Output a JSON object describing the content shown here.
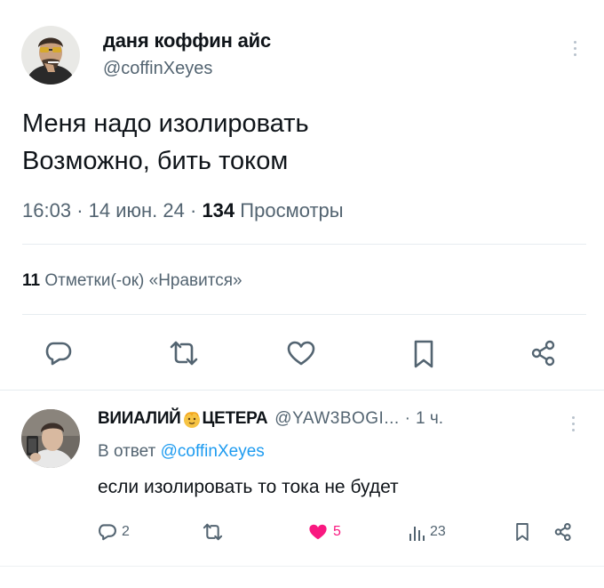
{
  "tweet": {
    "author_name": "даня коффин айс",
    "author_handle": "@coffinXeyes",
    "text_line1": "Меня надо изолировать",
    "text_line2": "Возможно, бить током",
    "time": "16:03",
    "sep1": "·",
    "date": "14 июн. 24",
    "sep2": "·",
    "views_count": "134",
    "views_label": "Просмотры",
    "likes_count": "11",
    "likes_label": "Отметки(-ок) «Нравится»"
  },
  "reply": {
    "author_name_part1": "ВИИАЛИЙ",
    "author_name_part2": "ЦЕТЕРА",
    "author_handle": "@YAW3BOGI...",
    "sep": "·",
    "time": "1 ч.",
    "reply_to_prefix": "В ответ",
    "reply_to_handle": "@coffinXeyes",
    "text": "если изолировать то тока не будет",
    "reply_count": "2",
    "like_count": "5",
    "views_count": "23"
  },
  "colors": {
    "text": "#0f1419",
    "secondary": "#536471",
    "link": "#1d9bf0",
    "like": "#f91880",
    "divider": "#e6ecf0"
  },
  "icons": {
    "main_actions": [
      "reply-icon",
      "retweet-icon",
      "like-icon",
      "bookmark-icon",
      "share-icon"
    ],
    "reply_actions": [
      "reply-icon",
      "retweet-icon",
      "like-icon-filled",
      "views-icon",
      "bookmark-icon",
      "share-icon"
    ]
  }
}
